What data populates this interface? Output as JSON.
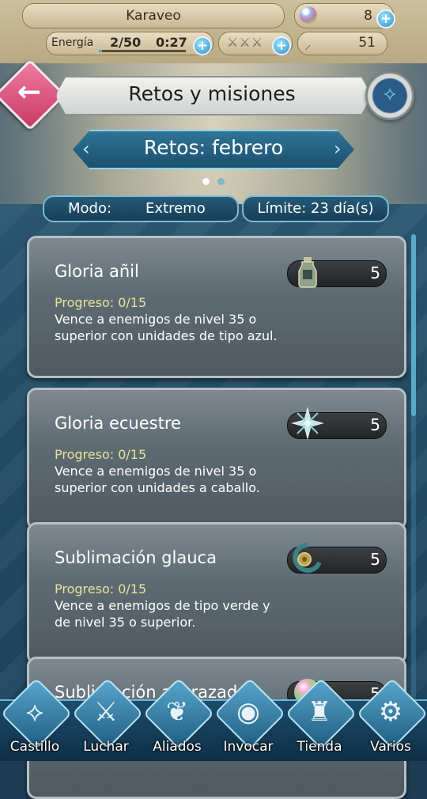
{
  "header": {
    "player_name": "Karaveo",
    "orbs": "8",
    "energy_label": "Energía",
    "energy_value": "2/50",
    "energy_fraction": 0.04,
    "energy_timer": "0:27",
    "swords": "⚔⚔⚔",
    "feathers": "51"
  },
  "title_row": {
    "title": "Retos y misiones",
    "subtitle": "Retos: febrero",
    "page_dots": {
      "count": 2,
      "active": 0
    }
  },
  "filters": {
    "mode_label": "Modo:",
    "mode_value": "Extremo",
    "limit": "Límite: 23 día(s)"
  },
  "quests": [
    {
      "name": "Gloria añil",
      "reward_icon": "potion-icon",
      "reward_count": "5",
      "progress": "Progreso: 0/15",
      "description": "Vence a enemigos de nivel 35 o superior con unidades de tipo azul."
    },
    {
      "name": "Gloria ecuestre",
      "reward_icon": "badge-icon",
      "reward_count": "5",
      "progress": "Progreso: 0/15",
      "description": "Vence a enemigos de nivel 35 o superior con unidades a caballo."
    },
    {
      "name": "Sublimación glauca",
      "reward_icon": "crest-icon",
      "reward_count": "5",
      "progress": "Progreso: 0/15",
      "description": "Vence a enemigos de tipo verde y de nivel 35 o superior."
    },
    {
      "name": "Sublimación acorazada",
      "reward_icon": "orb-icon",
      "reward_count": "5"
    }
  ],
  "nav": [
    {
      "label": "Castillo",
      "icon": "castle-crest-icon"
    },
    {
      "label": "Luchar",
      "icon": "crossed-swords-icon"
    },
    {
      "label": "Aliados",
      "icon": "wing-icon"
    },
    {
      "label": "Invocar",
      "icon": "orb-icon"
    },
    {
      "label": "Tienda",
      "icon": "castle-icon"
    },
    {
      "label": "Varios",
      "icon": "gear-icon"
    }
  ],
  "colors": {
    "accent": "#2c8fc4",
    "back_button": "#c83a66",
    "progress_text": "#e7e49a"
  }
}
